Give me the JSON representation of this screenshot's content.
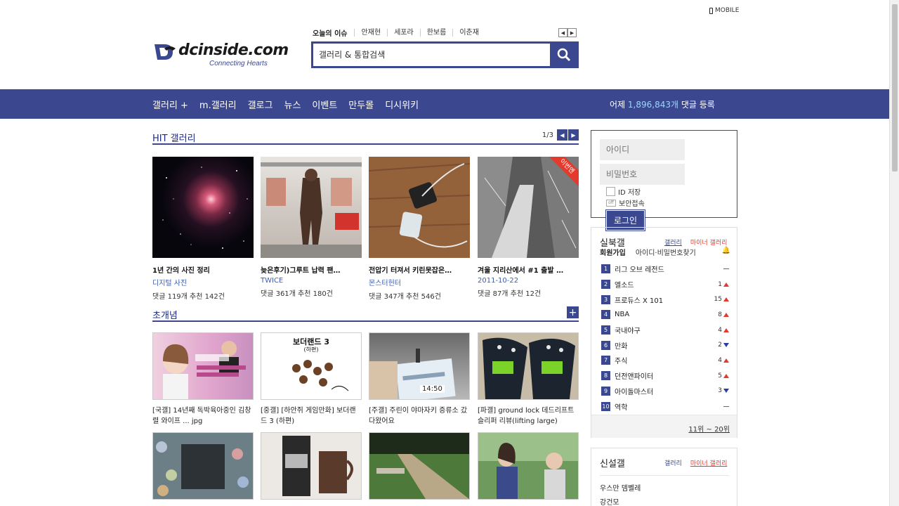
{
  "header": {
    "mobile_label": "MOBILE",
    "logo_text": "dcinside.com",
    "logo_tagline": "Connecting Hearts",
    "issue_label": "오늘의 이슈",
    "issues": [
      "안재현",
      "세포라",
      "한보름",
      "이춘재"
    ],
    "search_placeholder": "갤러리 & 통합검색"
  },
  "nav": {
    "items": [
      "갤러리 +",
      "m.갤러리",
      "갤로그",
      "뉴스",
      "이벤트",
      "만두몰",
      "디시위키"
    ],
    "stat_prefix": "어제 ",
    "stat_count": "1,896,843개",
    "stat_suffix": " 댓글 등록"
  },
  "hit": {
    "title": "HIT 갤러리",
    "page": "1/3",
    "ribbon": "이번엔",
    "items": [
      {
        "title": "1년 간의 사진 정리",
        "gallery": "디지털 사진",
        "meta": "댓글 119개 추천 142건"
      },
      {
        "title": "늦은후기)그루트 납력 팬…",
        "gallery": "TWICE",
        "meta": "댓글 361개 추천 180건"
      },
      {
        "title": "전압기 터져서 키린못잡은…",
        "gallery": "몬스터헌터",
        "meta": "댓글 347개 추천 546건"
      },
      {
        "title": "겨울 지리산에서 #1 출발 …",
        "gallery": "2011-10-22",
        "meta": "댓글 87개 추천 12건"
      }
    ]
  },
  "concept": {
    "title": "초개념",
    "items": [
      {
        "caption": "[국갤] 14년째 독박육아중인 김창렬 와이프 ... jpg"
      },
      {
        "caption": "[중갤] [하안쥐 게임만화] 보더랜드 3 (하편)"
      },
      {
        "caption": "[주갤] 주린이 야마자키 증류소 갔다왔어요"
      },
      {
        "caption": "[파갤] ground lock 데드리프트 슬리퍼 리뷰(lifting large)"
      }
    ],
    "thumb2_title": "보더랜드 3",
    "thumb2_sub": "(하편)",
    "thumb3_text": "14:50"
  },
  "login": {
    "id_placeholder": "아이디",
    "pw_placeholder": "비밀번호",
    "save_id": "ID 저장",
    "secure": "보안접속",
    "off": "off",
    "button": "로그인"
  },
  "realtime": {
    "title": "실북갤",
    "tab_gallery": "갤러리",
    "tab_minor": "마이너 갤러리",
    "join": "회원가입",
    "find": "아이디·비밀번호찾기",
    "rows": [
      {
        "n": "1",
        "name": "리그 오브 레전드",
        "change": "",
        "dir": "eq"
      },
      {
        "n": "2",
        "name": "엘소드",
        "change": "1",
        "dir": "up"
      },
      {
        "n": "3",
        "name": "프로듀스 X 101",
        "change": "15",
        "dir": "up"
      },
      {
        "n": "4",
        "name": "NBA",
        "change": "8",
        "dir": "up"
      },
      {
        "n": "5",
        "name": "국내야구",
        "change": "4",
        "dir": "up"
      },
      {
        "n": "6",
        "name": "만화",
        "change": "2",
        "dir": "down"
      },
      {
        "n": "7",
        "name": "주식",
        "change": "4",
        "dir": "up"
      },
      {
        "n": "8",
        "name": "던전앤파이터",
        "change": "5",
        "dir": "up"
      },
      {
        "n": "9",
        "name": "아이돌마스터",
        "change": "3",
        "dir": "down"
      },
      {
        "n": "10",
        "name": "역학",
        "change": "",
        "dir": "eq"
      }
    ],
    "more": "11위 ~ 20위"
  },
  "newgal": {
    "title": "신설갤",
    "tab_gallery": "갤러리",
    "tab_minor": "마이너 갤러리",
    "items": [
      "우스만 뎀벨레",
      "강건모"
    ]
  },
  "colors": {
    "brand": "#3b4890",
    "accent_red": "#e43a2d",
    "link_blue": "#3b5bb5"
  }
}
